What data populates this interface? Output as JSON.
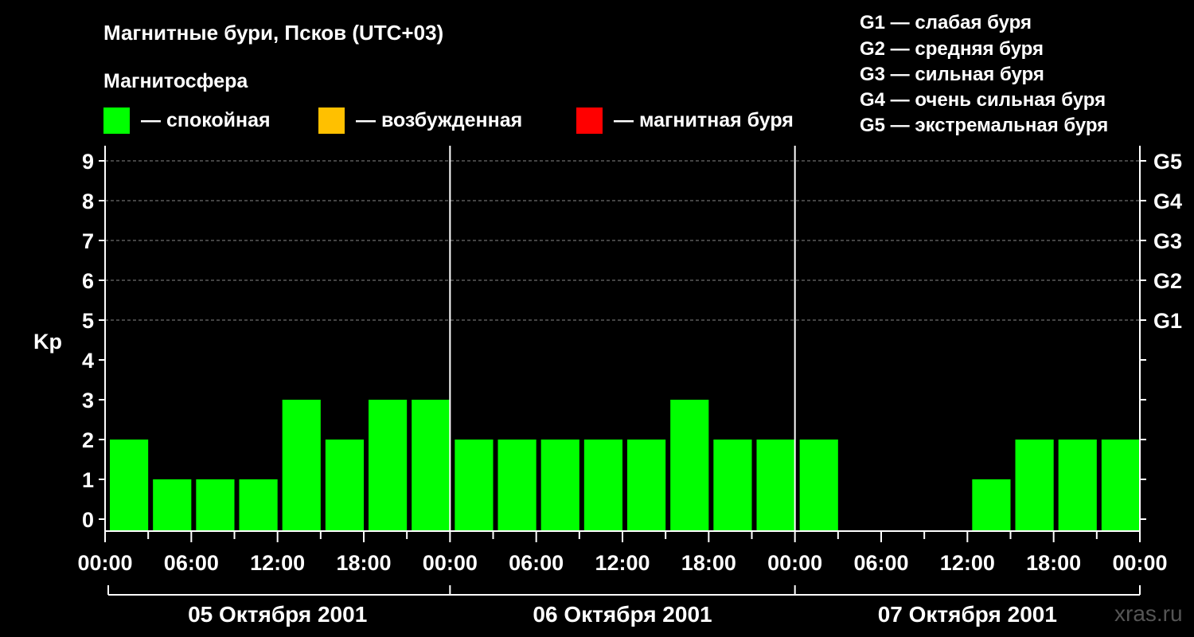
{
  "title": "Магнитные бури, Псков (UTC+03)",
  "subtitle": "Магнитосфера",
  "legend": [
    {
      "label": "— спокойная",
      "color": "#00ff00"
    },
    {
      "label": "— возбужденная",
      "color": "#ffc000"
    },
    {
      "label": "— магнитная буря",
      "color": "#ff0000"
    }
  ],
  "g_legend": [
    "G1 — слабая буря",
    "G2 — средняя буря",
    "G3 — сильная буря",
    "G4 — очень сильная буря",
    "G5 — экстремальная буря"
  ],
  "watermark": "xras.ru",
  "chart_data": {
    "type": "bar",
    "ylabel": "Kp",
    "ylim": [
      0,
      9
    ],
    "yticks": [
      "0",
      "1",
      "2",
      "3",
      "4",
      "5",
      "6",
      "7",
      "8",
      "9"
    ],
    "right_ticks": [
      {
        "value": 5,
        "label": "G1"
      },
      {
        "value": 6,
        "label": "G2"
      },
      {
        "value": 7,
        "label": "G3"
      },
      {
        "value": 8,
        "label": "G4"
      },
      {
        "value": 9,
        "label": "G5"
      }
    ],
    "xtick_labels": [
      "00:00",
      "06:00",
      "12:00",
      "18:00",
      "00:00",
      "06:00",
      "12:00",
      "18:00",
      "00:00",
      "06:00",
      "12:00",
      "18:00",
      "00:00"
    ],
    "days": [
      "05 Октября 2001",
      "06 Октября 2001",
      "07 Октября 2001"
    ],
    "bar_interval_hours": 3,
    "values": [
      2,
      1,
      1,
      1,
      3,
      2,
      3,
      3,
      2,
      2,
      2,
      2,
      2,
      3,
      2,
      2,
      2,
      0,
      0,
      0,
      1,
      2,
      2,
      2
    ],
    "bar_color": "#00ff00",
    "grid": "dashed at 5, 6, 7, 8, 9"
  }
}
